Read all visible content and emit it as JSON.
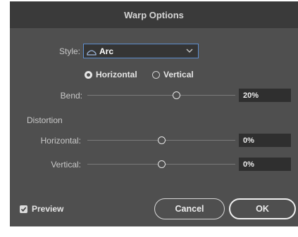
{
  "dialog": {
    "title": "Warp Options"
  },
  "style": {
    "label": "Style:",
    "value": "Arc",
    "icon": "arc-icon"
  },
  "orientation": {
    "horizontal_label": "Horizontal",
    "vertical_label": "Vertical",
    "selected": "Horizontal"
  },
  "bend": {
    "label": "Bend:",
    "value_text": "20%",
    "value": 20
  },
  "distortion": {
    "heading": "Distortion",
    "horizontal": {
      "label": "Horizontal:",
      "value_text": "0%",
      "value": 0
    },
    "vertical": {
      "label": "Vertical:",
      "value_text": "0%",
      "value": 0
    }
  },
  "preview": {
    "label": "Preview",
    "checked": true
  },
  "buttons": {
    "cancel": "Cancel",
    "ok": "OK"
  },
  "colors": {
    "dialog_bg": "#4f4f4f",
    "titlebar_bg": "#3a3a3a",
    "focus_border": "#5f8fd0"
  }
}
